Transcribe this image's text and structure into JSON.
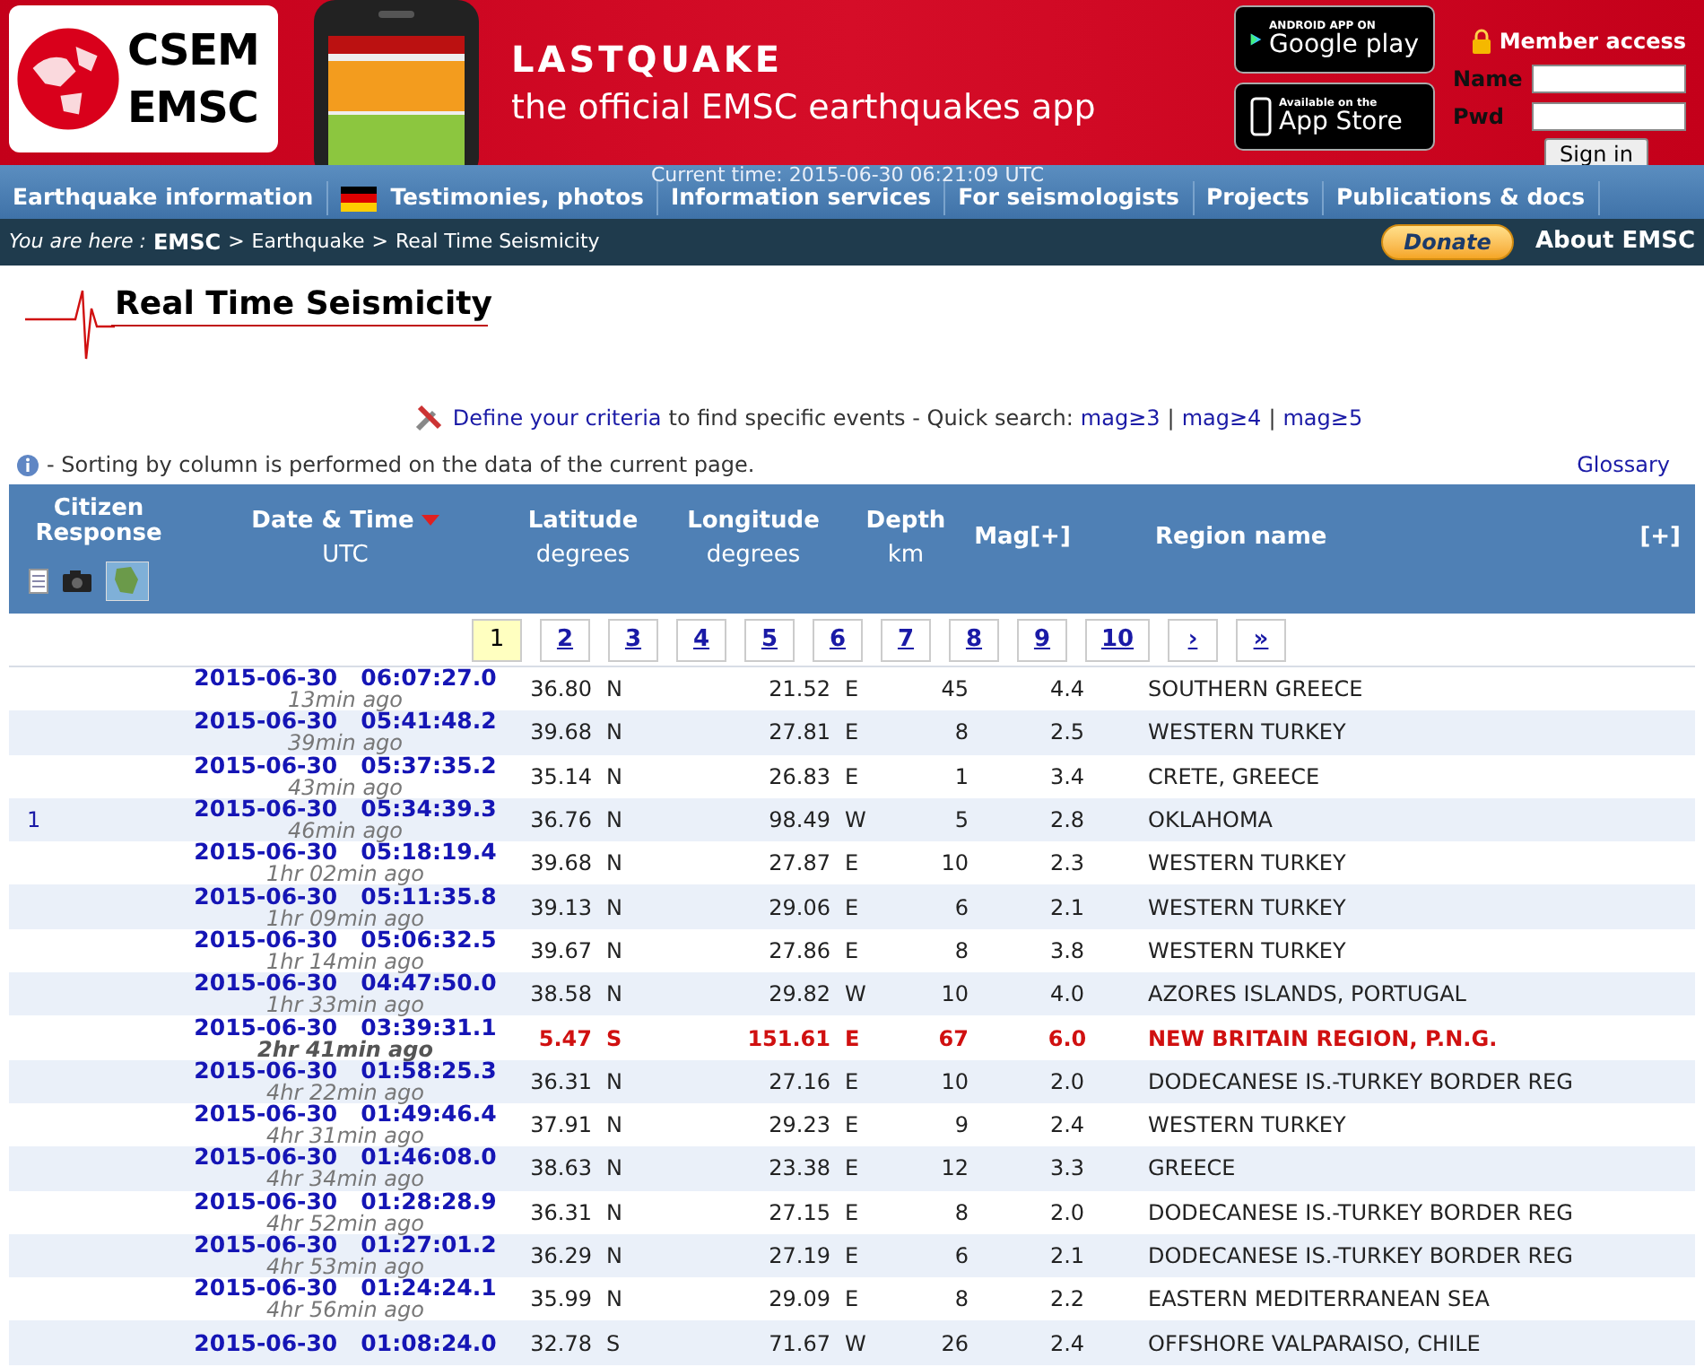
{
  "header": {
    "logo_top": "CSEM",
    "logo_bottom": "EMSC",
    "app_title": "LASTQUAKE",
    "app_subtitle": "the official EMSC earthquakes app",
    "google_play": {
      "small": "ANDROID APP ON",
      "big": "Google play"
    },
    "app_store": {
      "small": "Available on the",
      "big": "App Store"
    },
    "member_access": "Member access",
    "name_label": "Name",
    "pwd_label": "Pwd",
    "sign_in": "Sign in"
  },
  "current_time": "Current time: 2015-06-30 06:21:09 UTC",
  "nav": [
    "Earthquake information",
    "Testimonies, photos",
    "Information services",
    "For seismologists",
    "Projects",
    "Publications & docs"
  ],
  "breadcrumb": {
    "prefix": "You are here :",
    "items": [
      "EMSC",
      "Earthquake",
      "Real Time Seismicity"
    ],
    "separator": ">",
    "donate": "Donate",
    "about": "About EMSC"
  },
  "page_title": "Real Time Seismicity",
  "criteria": {
    "link": "Define your criteria",
    "text": "to find specific events - Quick search:",
    "quick": [
      "mag≥3",
      "mag≥4",
      "mag≥5"
    ],
    "separator": "|"
  },
  "note": "- Sorting by column is performed on the data of the current page.",
  "glossary": "Glossary",
  "columns": {
    "citizen": "Citizen Response",
    "date": "Date & Time",
    "date_sub": "UTC",
    "lat": "Latitude",
    "lat_sub": "degrees",
    "lon": "Longitude",
    "lon_sub": "degrees",
    "depth": "Depth",
    "depth_sub": "km",
    "mag": "Mag[+]",
    "region": "Region name",
    "more": "[+]"
  },
  "pages": [
    {
      "label": "1",
      "selected": true
    },
    {
      "label": "2",
      "selected": false
    },
    {
      "label": "3",
      "selected": false
    },
    {
      "label": "4",
      "selected": false
    },
    {
      "label": "5",
      "selected": false
    },
    {
      "label": "6",
      "selected": false
    },
    {
      "label": "7",
      "selected": false
    },
    {
      "label": "8",
      "selected": false
    },
    {
      "label": "9",
      "selected": false
    },
    {
      "label": "10",
      "selected": false
    },
    {
      "label": "›",
      "selected": false
    },
    {
      "label": "»",
      "selected": false
    }
  ],
  "rows": [
    {
      "citizen": "",
      "date": "2015-06-30",
      "time": "06:07:27.0",
      "ago": "13min ago",
      "lat": "36.80",
      "lat_dir": "N",
      "lon": "21.52",
      "lon_dir": "E",
      "depth": "45",
      "mag": "4.4",
      "region": "SOUTHERN GREECE",
      "highlighted": false
    },
    {
      "citizen": "",
      "date": "2015-06-30",
      "time": "05:41:48.2",
      "ago": "39min ago",
      "lat": "39.68",
      "lat_dir": "N",
      "lon": "27.81",
      "lon_dir": "E",
      "depth": "8",
      "mag": "2.5",
      "region": "WESTERN TURKEY",
      "highlighted": false
    },
    {
      "citizen": "",
      "date": "2015-06-30",
      "time": "05:37:35.2",
      "ago": "43min ago",
      "lat": "35.14",
      "lat_dir": "N",
      "lon": "26.83",
      "lon_dir": "E",
      "depth": "1",
      "mag": "3.4",
      "region": "CRETE, GREECE",
      "highlighted": false
    },
    {
      "citizen": "1",
      "date": "2015-06-30",
      "time": "05:34:39.3",
      "ago": "46min ago",
      "lat": "36.76",
      "lat_dir": "N",
      "lon": "98.49",
      "lon_dir": "W",
      "depth": "5",
      "mag": "2.8",
      "region": "OKLAHOMA",
      "highlighted": false
    },
    {
      "citizen": "",
      "date": "2015-06-30",
      "time": "05:18:19.4",
      "ago": "1hr 02min ago",
      "lat": "39.68",
      "lat_dir": "N",
      "lon": "27.87",
      "lon_dir": "E",
      "depth": "10",
      "mag": "2.3",
      "region": "WESTERN TURKEY",
      "highlighted": false
    },
    {
      "citizen": "",
      "date": "2015-06-30",
      "time": "05:11:35.8",
      "ago": "1hr 09min ago",
      "lat": "39.13",
      "lat_dir": "N",
      "lon": "29.06",
      "lon_dir": "E",
      "depth": "6",
      "mag": "2.1",
      "region": "WESTERN TURKEY",
      "highlighted": false
    },
    {
      "citizen": "",
      "date": "2015-06-30",
      "time": "05:06:32.5",
      "ago": "1hr 14min ago",
      "lat": "39.67",
      "lat_dir": "N",
      "lon": "27.86",
      "lon_dir": "E",
      "depth": "8",
      "mag": "3.8",
      "region": "WESTERN TURKEY",
      "highlighted": false
    },
    {
      "citizen": "",
      "date": "2015-06-30",
      "time": "04:47:50.0",
      "ago": "1hr 33min ago",
      "lat": "38.58",
      "lat_dir": "N",
      "lon": "29.82",
      "lon_dir": "W",
      "depth": "10",
      "mag": "4.0",
      "region": "AZORES ISLANDS, PORTUGAL",
      "highlighted": false
    },
    {
      "citizen": "",
      "date": "2015-06-30",
      "time": "03:39:31.1",
      "ago": "2hr 41min ago",
      "lat": "5.47",
      "lat_dir": "S",
      "lon": "151.61",
      "lon_dir": "E",
      "depth": "67",
      "mag": "6.0",
      "region": "NEW BRITAIN REGION, P.N.G.",
      "highlighted": true
    },
    {
      "citizen": "",
      "date": "2015-06-30",
      "time": "01:58:25.3",
      "ago": "4hr 22min ago",
      "lat": "36.31",
      "lat_dir": "N",
      "lon": "27.16",
      "lon_dir": "E",
      "depth": "10",
      "mag": "2.0",
      "region": "DODECANESE IS.-TURKEY BORDER REG",
      "highlighted": false
    },
    {
      "citizen": "",
      "date": "2015-06-30",
      "time": "01:49:46.4",
      "ago": "4hr 31min ago",
      "lat": "37.91",
      "lat_dir": "N",
      "lon": "29.23",
      "lon_dir": "E",
      "depth": "9",
      "mag": "2.4",
      "region": "WESTERN TURKEY",
      "highlighted": false
    },
    {
      "citizen": "",
      "date": "2015-06-30",
      "time": "01:46:08.0",
      "ago": "4hr 34min ago",
      "lat": "38.63",
      "lat_dir": "N",
      "lon": "23.38",
      "lon_dir": "E",
      "depth": "12",
      "mag": "3.3",
      "region": "GREECE",
      "highlighted": false
    },
    {
      "citizen": "",
      "date": "2015-06-30",
      "time": "01:28:28.9",
      "ago": "4hr 52min ago",
      "lat": "36.31",
      "lat_dir": "N",
      "lon": "27.15",
      "lon_dir": "E",
      "depth": "8",
      "mag": "2.0",
      "region": "DODECANESE IS.-TURKEY BORDER REG",
      "highlighted": false
    },
    {
      "citizen": "",
      "date": "2015-06-30",
      "time": "01:27:01.2",
      "ago": "4hr 53min ago",
      "lat": "36.29",
      "lat_dir": "N",
      "lon": "27.19",
      "lon_dir": "E",
      "depth": "6",
      "mag": "2.1",
      "region": "DODECANESE IS.-TURKEY BORDER REG",
      "highlighted": false
    },
    {
      "citizen": "",
      "date": "2015-06-30",
      "time": "01:24:24.1",
      "ago": "4hr 56min ago",
      "lat": "35.99",
      "lat_dir": "N",
      "lon": "29.09",
      "lon_dir": "E",
      "depth": "8",
      "mag": "2.2",
      "region": "EASTERN MEDITERRANEAN SEA",
      "highlighted": false
    },
    {
      "citizen": "",
      "date": "2015-06-30",
      "time": "01:08:24.0",
      "ago": "",
      "lat": "32.78",
      "lat_dir": "S",
      "lon": "71.67",
      "lon_dir": "W",
      "depth": "26",
      "mag": "2.4",
      "region": "OFFSHORE VALPARAISO, CHILE",
      "highlighted": false
    }
  ]
}
